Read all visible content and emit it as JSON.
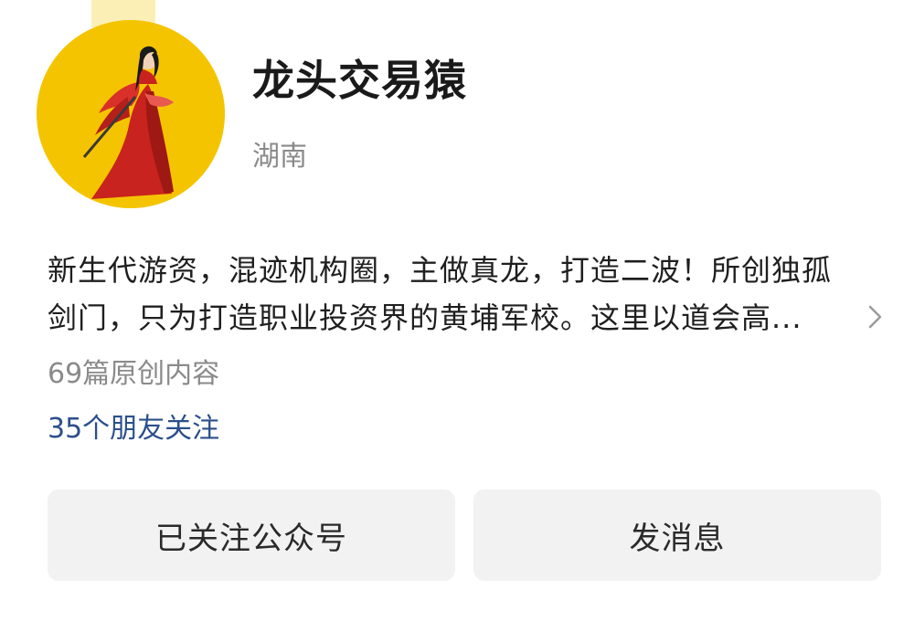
{
  "profile": {
    "name": "龙头交易猿",
    "region": "湖南",
    "avatar_icon": "red-robed-swordsman-avatar",
    "intro_lines": [
      "新生代游资，混迹机构圈，主做真龙，打造二波！所创独孤",
      "剑门，只为打造职业投资界的黄埔军校。这里以道会高..."
    ],
    "articles_count": "69篇原创内容",
    "friends_following": "35个朋友关注"
  },
  "actions": {
    "follow_label": "已关注公众号",
    "message_label": "发消息"
  },
  "icons": {
    "expand": "chevron-right-icon"
  },
  "colors": {
    "avatar_bg": "#f5c400",
    "friends_link": "#2b4f8c",
    "secondary_text": "#8a8a8a",
    "button_bg": "#f2f2f2"
  }
}
